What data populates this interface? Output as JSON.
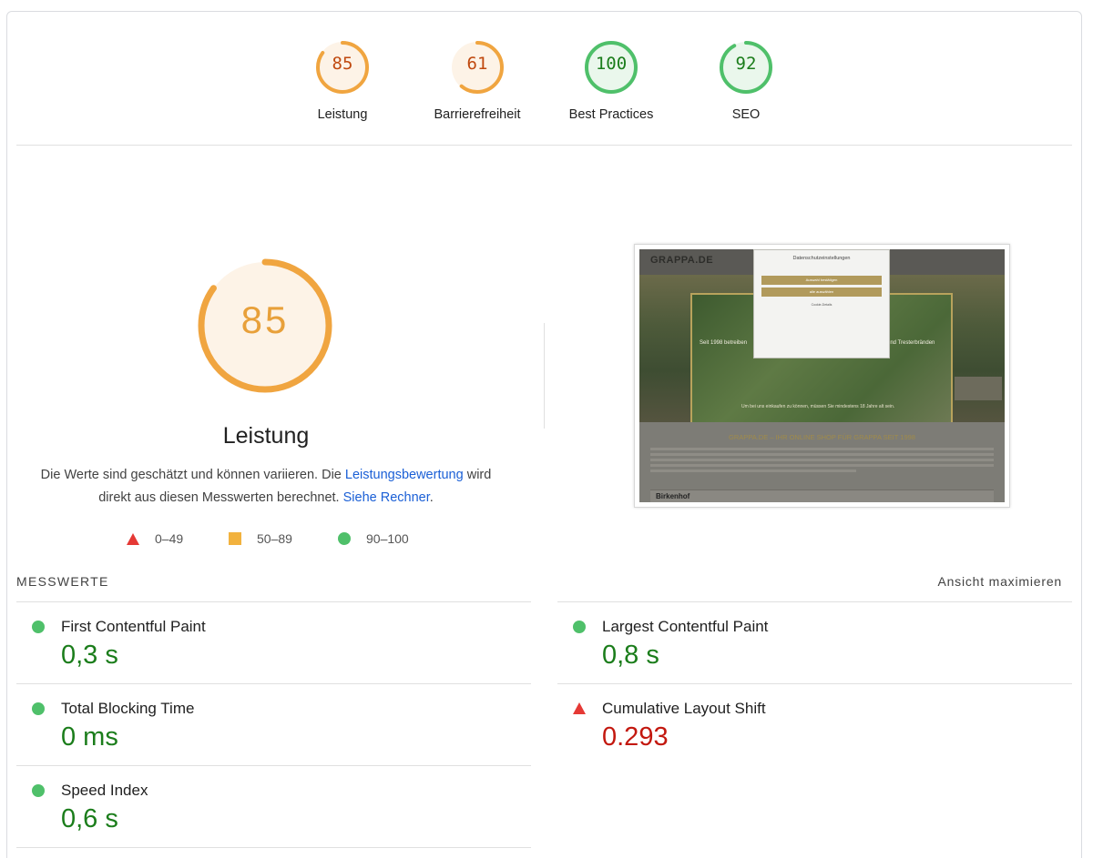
{
  "colors": {
    "pass": "#1b7d1b",
    "average": "#e8a03a",
    "fail": "#c3180f",
    "link": "#1a5fd6"
  },
  "gauges": [
    {
      "score": "85",
      "label": "Leistung",
      "rating": "average",
      "fraction": 0.85
    },
    {
      "score": "61",
      "label": "Barrierefreiheit",
      "rating": "average",
      "fraction": 0.61
    },
    {
      "score": "100",
      "label": "Best Practices",
      "rating": "pass",
      "fraction": 1.0
    },
    {
      "score": "92",
      "label": "SEO",
      "rating": "pass",
      "fraction": 0.92
    }
  ],
  "performance": {
    "score": "85",
    "fraction": 0.85,
    "title": "Leistung",
    "desc_prefix": "Die Werte sind geschätzt und können variieren. Die ",
    "desc_link1": "Leistungsbewertung",
    "desc_middle": " wird direkt aus diesen Messwerten berechnet. ",
    "desc_link2": "Siehe Rechner",
    "desc_suffix": "."
  },
  "legend": [
    {
      "icon": "red-triangle-icon",
      "range": "0–49"
    },
    {
      "icon": "orange-square-icon",
      "range": "50–89"
    },
    {
      "icon": "green-circle-icon",
      "range": "90–100"
    }
  ],
  "screenshot": {
    "logo": "GRAPPA.DE",
    "hero_text_left": "Seit 1998 betreiben",
    "hero_text_right": "und Tresterbränden",
    "hero_sub": "Um bei uns einkaufen zu können, müssen Sie mindestens 18 Jahre alt sein.",
    "modal_title": "Datenschutzeinstellungen",
    "modal_btn1": "Auswahl bestätigen",
    "modal_btn2": "alle auswählen",
    "modal_link": "Cookie-Details",
    "content_title": "GRAPPA.DE – IHR ONLINE SHOP FÜR GRAPPA SEIT 1998",
    "bottom_label": "Birkenhof"
  },
  "metrics": {
    "section_label": "MESSWERTE",
    "toggle_label": "Ansicht maximieren",
    "left": [
      {
        "name": "First Contentful Paint",
        "value": "0,3 s",
        "rating": "pass"
      },
      {
        "name": "Total Blocking Time",
        "value": "0 ms",
        "rating": "pass"
      },
      {
        "name": "Speed Index",
        "value": "0,6 s",
        "rating": "pass"
      }
    ],
    "right": [
      {
        "name": "Largest Contentful Paint",
        "value": "0,8 s",
        "rating": "pass"
      },
      {
        "name": "Cumulative Layout Shift",
        "value": "0.293",
        "rating": "fail"
      }
    ]
  }
}
